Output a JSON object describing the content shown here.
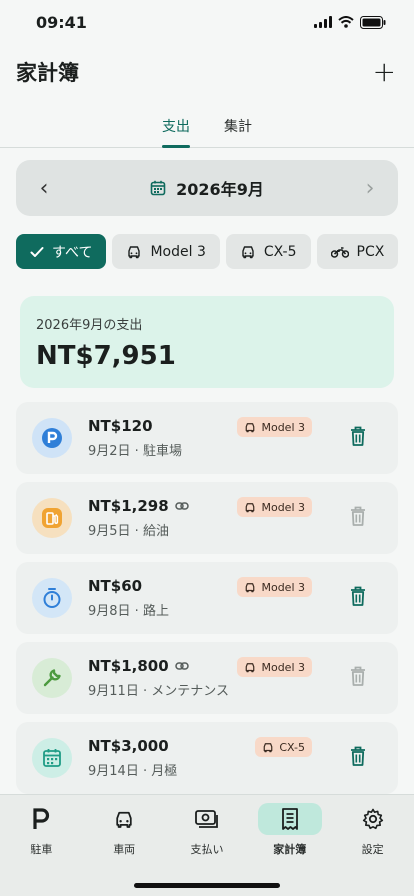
{
  "status": {
    "time": "09:41"
  },
  "header": {
    "title": "家計簿",
    "add_label": "+"
  },
  "tabs": [
    {
      "label": "支出",
      "active": true
    },
    {
      "label": "集計",
      "active": false
    }
  ],
  "month_nav": {
    "label": "2026年9月",
    "prev": "‹",
    "next": "›"
  },
  "filters": [
    {
      "label": "すべて",
      "icon": "check-icon",
      "active": true
    },
    {
      "label": "Model 3",
      "icon": "car-icon",
      "active": false
    },
    {
      "label": "CX-5",
      "icon": "car-icon",
      "active": false
    },
    {
      "label": "PCX",
      "icon": "motorcycle-icon",
      "active": false
    }
  ],
  "summary": {
    "label": "2026年9月の支出",
    "amount": "NT$7,951"
  },
  "expenses": [
    {
      "amount": "NT$120",
      "sub": "9月2日 · 駐車場",
      "vehicle": "Model 3",
      "icon": "parking-icon",
      "linked": false,
      "deletable": true
    },
    {
      "amount": "NT$1,298",
      "sub": "9月5日 · 給油",
      "vehicle": "Model 3",
      "icon": "fuel-icon",
      "linked": true,
      "deletable": false
    },
    {
      "amount": "NT$60",
      "sub": "9月8日 · 路上",
      "vehicle": "Model 3",
      "icon": "timer-icon",
      "linked": false,
      "deletable": true
    },
    {
      "amount": "NT$1,800",
      "sub": "9月11日 · メンテナンス",
      "vehicle": "Model 3",
      "icon": "wrench-icon",
      "linked": true,
      "deletable": false
    },
    {
      "amount": "NT$3,000",
      "sub": "9月14日 · 月極",
      "vehicle": "CX-5",
      "icon": "calendar-icon",
      "linked": false,
      "deletable": true
    }
  ],
  "bottom_nav": [
    {
      "label": "駐車",
      "icon": "parking-letter-icon",
      "active": false
    },
    {
      "label": "車両",
      "icon": "car-icon",
      "active": false
    },
    {
      "label": "支払い",
      "icon": "payment-icon",
      "active": false
    },
    {
      "label": "家計簿",
      "icon": "receipt-icon",
      "active": true
    },
    {
      "label": "設定",
      "icon": "gear-icon",
      "active": false
    }
  ],
  "colors": {
    "accent": "#0f6b5e",
    "badge": "#f8d9c8",
    "summary_bg": "#dcf3ea"
  }
}
